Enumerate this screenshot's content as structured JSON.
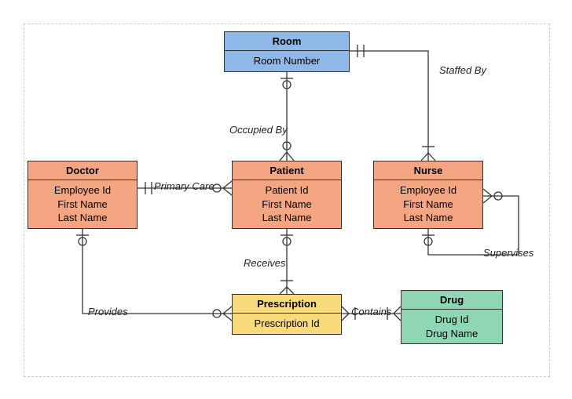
{
  "diagram": {
    "entities": {
      "room": {
        "title": "Room",
        "attrs": [
          "Room Number"
        ]
      },
      "doctor": {
        "title": "Doctor",
        "attrs": [
          "Employee Id",
          "First Name",
          "Last Name"
        ]
      },
      "patient": {
        "title": "Patient",
        "attrs": [
          "Patient Id",
          "First Name",
          "Last Name"
        ]
      },
      "nurse": {
        "title": "Nurse",
        "attrs": [
          "Employee Id",
          "First Name",
          "Last Name"
        ]
      },
      "prescription": {
        "title": "Prescription",
        "attrs": [
          "Prescription Id"
        ]
      },
      "drug": {
        "title": "Drug",
        "attrs": [
          "Drug Id",
          "Drug Name"
        ]
      }
    },
    "relationships": {
      "staffed_by": "Staffed By",
      "occupied_by": "Occupied By",
      "primary_care": "Primary Care",
      "receives": "Receives",
      "provides": "Provides",
      "contains": "Contains",
      "supervises": "Supervises"
    }
  },
  "style": {
    "fill": {
      "blue": "#8fb8e8",
      "peach": "#f4a582",
      "yellow": "#f8da7a",
      "green": "#8fd6b4"
    }
  },
  "chart_data": {
    "type": "er-diagram",
    "entities": [
      {
        "name": "Room",
        "attributes": [
          "Room Number"
        ]
      },
      {
        "name": "Doctor",
        "attributes": [
          "Employee Id",
          "First Name",
          "Last Name"
        ]
      },
      {
        "name": "Patient",
        "attributes": [
          "Patient Id",
          "First Name",
          "Last Name"
        ]
      },
      {
        "name": "Nurse",
        "attributes": [
          "Employee Id",
          "First Name",
          "Last Name"
        ]
      },
      {
        "name": "Prescription",
        "attributes": [
          "Prescription Id"
        ]
      },
      {
        "name": "Drug",
        "attributes": [
          "Drug Id",
          "Drug Name"
        ]
      }
    ],
    "relationships": [
      {
        "label": "Staffed By",
        "between": [
          "Room",
          "Nurse"
        ],
        "card": [
          "one",
          "many"
        ]
      },
      {
        "label": "Occupied By",
        "between": [
          "Room",
          "Patient"
        ],
        "card": [
          "one-optional",
          "many-optional"
        ]
      },
      {
        "label": "Primary Care",
        "between": [
          "Doctor",
          "Patient"
        ],
        "card": [
          "one",
          "many-optional"
        ]
      },
      {
        "label": "Receives",
        "between": [
          "Patient",
          "Prescription"
        ],
        "card": [
          "one-optional",
          "many"
        ]
      },
      {
        "label": "Provides",
        "between": [
          "Doctor",
          "Prescription"
        ],
        "card": [
          "one-optional",
          "many-optional"
        ]
      },
      {
        "label": "Contains",
        "between": [
          "Prescription",
          "Drug"
        ],
        "card": [
          "many",
          "many"
        ]
      },
      {
        "label": "Supervises",
        "between": [
          "Nurse",
          "Nurse"
        ],
        "card": [
          "one-optional",
          "many-optional"
        ]
      }
    ]
  }
}
